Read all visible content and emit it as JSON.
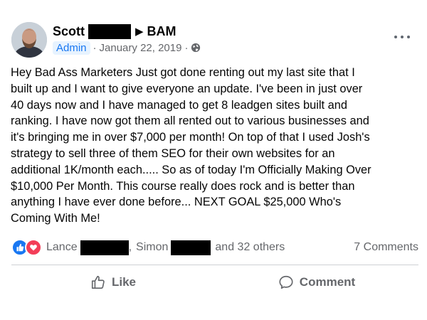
{
  "post": {
    "author": "Scott",
    "arrow": "▶",
    "group": "BAM",
    "badge": "Admin",
    "date": "January 22, 2019",
    "separator": "·",
    "privacy_icon": "globe-icon",
    "more_icon": "more-options-icon",
    "text": "Hey Bad Ass Marketers Just got done renting out my last site that I\nbuilt up and I want to give everyone an update. I've been in just over\n40 days now and I have managed to get 8 leadgen sites built and\nranking. I have now got them all rented out to various businesses and\nit's bringing me in over $7,000 per month! On top of that I used Josh's\nstrategy to sell three of them SEO for their own websites for an\nadditional 1K/month each..... So as of today I'm Officially Making Over\n$10,000 Per Month. This course really does rock and is better than\nanything I have ever done before... NEXT GOAL $25,000 Who's\nComing With Me!"
  },
  "reactions": {
    "icons": [
      "like-reaction-icon",
      "love-reaction-icon"
    ],
    "name1": "Lance",
    "comma": ",",
    "name2": "Simon",
    "others": "and 32 others",
    "comments": "7 Comments"
  },
  "actions": {
    "like": "Like",
    "comment": "Comment"
  },
  "colors": {
    "accent": "#1877f2",
    "love": "#f33e58",
    "secondary_text": "#65676b",
    "badge_bg": "#e7f3ff"
  }
}
